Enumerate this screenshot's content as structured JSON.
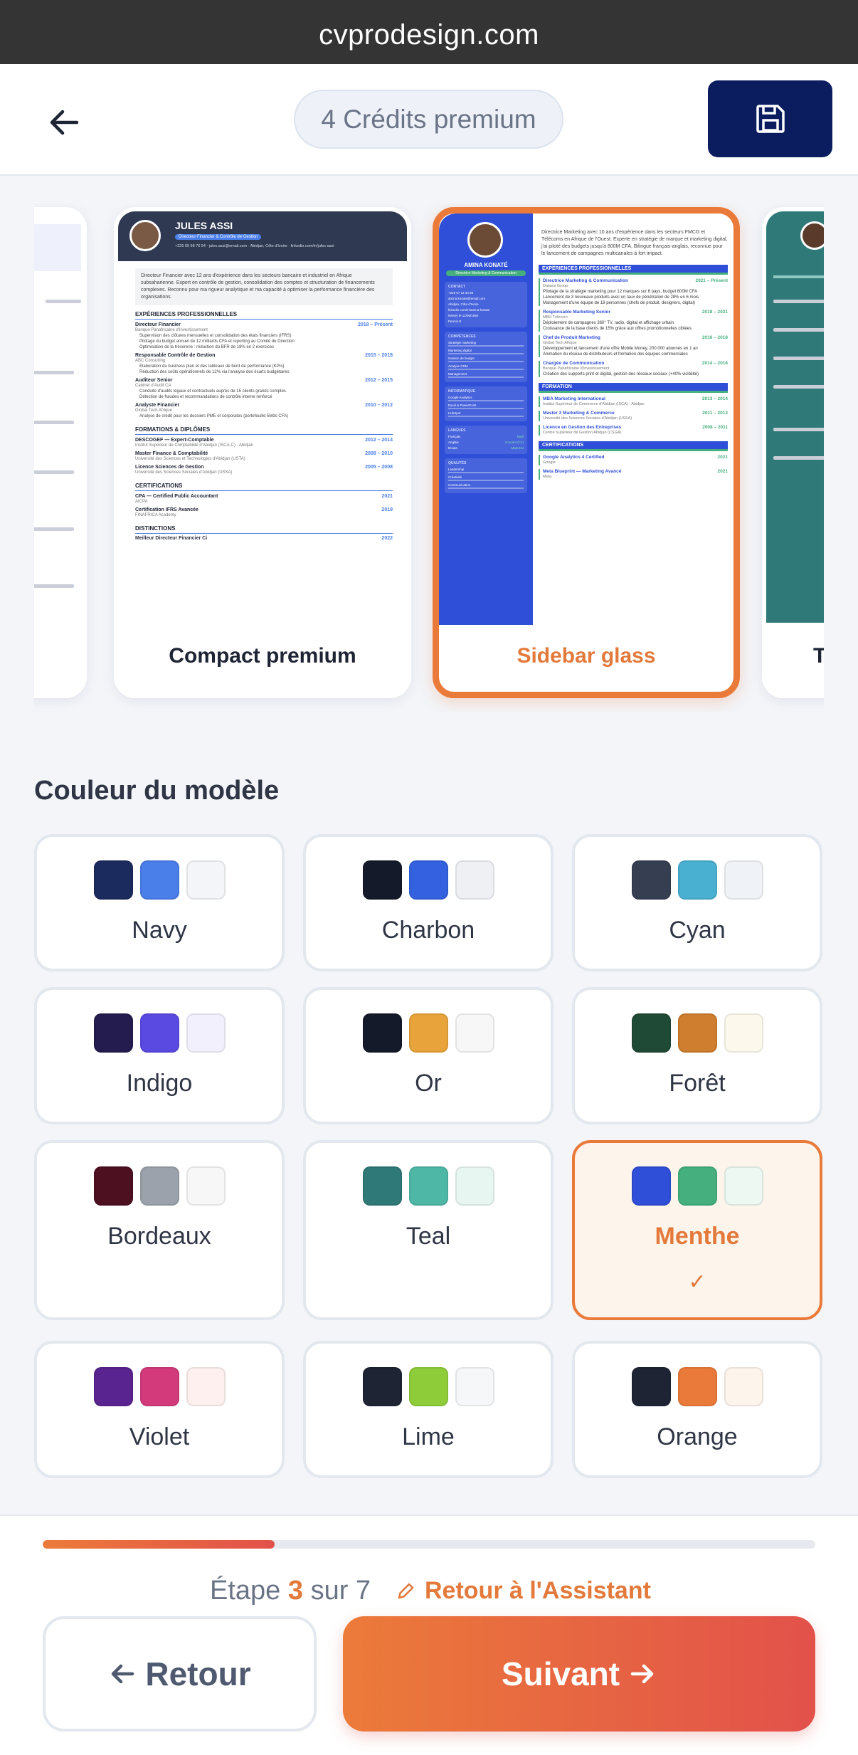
{
  "browser": {
    "url": "cvprodesign.com"
  },
  "header": {
    "credits": "4 Crédits premium"
  },
  "templates": [
    {
      "name": "Compact premium",
      "selected": false
    },
    {
      "name": "Sidebar glass",
      "selected": true
    }
  ],
  "resume_compact": {
    "name": "JULES ASSI",
    "title": "Directeur Financier & Contrôle de Gestion",
    "contact": "+225 05 98 76 54 · jules.assi@email.com · Abidjan, Côte d'Ivoire · linkedin.com/in/jules-assi",
    "summary": "Directeur Financier avec 12 ans d'expérience dans les secteurs bancaire et industriel en Afrique subsaharienne. Expert en contrôle de gestion, consolidation des comptes et structuration de financements complexes. Reconnu pour ma rigueur analytique et ma capacité à optimiser la performance financière des organisations.",
    "sec_exp": "EXPÉRIENCES PROFESSIONNELLES",
    "jobs": [
      {
        "role": "Directeur Financier",
        "date": "2018 – Présent",
        "org": "Banque Panafricaine d'Investissement",
        "bullets": [
          "Supervision des clôtures mensuelles et consolidation des états financiers (IFRS)",
          "Pilotage du budget annuel de 12 milliards CFA et reporting au Comité de Direction",
          "Optimisation de la trésorerie : réduction du BFR de 18% en 2 exercices"
        ]
      },
      {
        "role": "Responsable Contrôle de Gestion",
        "date": "2015 – 2018",
        "org": "ABC Consulting",
        "bullets": [
          "Élaboration du business plan et des tableaux de bord de performance (KPIs)",
          "Réduction des coûts opérationnels de 12% via l'analyse des écarts budgétaires"
        ]
      },
      {
        "role": "Auditeur Senior",
        "date": "2012 – 2015",
        "org": "Cabinet d'Audit CA",
        "bullets": [
          "Conduite d'audits légaux et contractuels auprès de 15 clients grands comptes",
          "Détection de fraudes et recommandations de contrôle interne renforcé"
        ]
      },
      {
        "role": "Analyste Financier",
        "date": "2010 – 2012",
        "org": "Global Tech Afrique",
        "bullets": [
          "Analyse de crédit pour les dossiers PME et corporates (portefeuille 5Mds CFA)"
        ]
      }
    ],
    "sec_edu": "FORMATIONS & DIPLÔMES",
    "edu": [
      {
        "role": "DESCOGEF — Expert-Comptable",
        "date": "2012 – 2014",
        "org": "Institut Supérieur de Comptabilité d'Abidjan (ISCA-C) - Abidjan"
      },
      {
        "role": "Master Finance & Comptabilité",
        "date": "2008 – 2010",
        "org": "Université des Sciences et Technologies d'Abidjan (USTA)"
      },
      {
        "role": "Licence Sciences de Gestion",
        "date": "2005 – 2008",
        "org": "Université des Sciences Sociales d'Abidjan (USSA)"
      }
    ],
    "sec_cert": "CERTIFICATIONS",
    "certs": [
      {
        "role": "CPA — Certified Public Accountant",
        "date": "2021",
        "org": "AICPA"
      },
      {
        "role": "Certification IFRS Avancée",
        "date": "2019",
        "org": "FINAFRICA Academy"
      }
    ],
    "sec_dist": "DISTINCTIONS",
    "dist": "Meilleur Directeur Financier Ci",
    "dist_date": "2022"
  },
  "resume_sidebar": {
    "name": "AMINA KONATÉ",
    "title": "Directrice Marketing & Communication",
    "summary": "Directrice Marketing avec 10 ans d'expérience dans les secteurs FMCG et Télécoms en Afrique de l'Ouest. Experte en stratégie de marque et marketing digital, j'ai piloté des budgets jusqu'à 800M CFA. Bilingue français-anglais, reconnue pour le lancement de campagnes multicanales à fort impact.",
    "contact_title": "CONTACT",
    "contact": [
      "+225 07 12 34 56",
      "amina.konate@email.com",
      "Abidjan, Côte d'Ivoire",
      "linkedin.com/in/amina-konate",
      "Née(e) le 12/05/1990",
      "Permis B"
    ],
    "skills_title": "COMPÉTENCES",
    "skills": [
      "Stratégie marketing",
      "Marketing digital",
      "Gestion de budget",
      "Analyse CRM",
      "Management"
    ],
    "info_title": "INFORMATIQUE",
    "info": [
      "Google Analytics",
      "Excel & PowerPoint",
      "HubSpot"
    ],
    "lang_title": "LANGUES",
    "langs": [
      [
        "Français",
        "Natif"
      ],
      [
        "Anglais",
        "Courant (C1)"
      ],
      [
        "Dioula",
        "Maternel"
      ]
    ],
    "qual_title": "QUALITÉS",
    "quals": [
      "Leadership",
      "Créativité",
      "Communication"
    ],
    "sec_exp": "EXPÉRIENCES PROFESSIONNELLES",
    "jobs": [
      {
        "role": "Directrice Marketing & Communication",
        "date": "2021 – Présent",
        "org": "Dataxis Group",
        "bullets": [
          "Pilotage de la stratégie marketing pour 12 marques sur 6 pays, budget 800M CFA",
          "Lancement de 3 nouveaux produits avec un taux de pénétration de 28% en 6 mois",
          "Management d'une équipe de 18 personnes (chefs de produit, designers, digital)"
        ]
      },
      {
        "role": "Responsable Marketing Senior",
        "date": "2018 – 2021",
        "org": "MBH Télécom",
        "bullets": [
          "Déploiement de campagnes 360° TV, radio, digital et affichage urbain",
          "Croissance de la base clients de 15% grâce aux offres promotionnelles ciblées"
        ]
      },
      {
        "role": "Chef de Produit Marketing",
        "date": "2016 – 2018",
        "org": "Global Tech Afrique",
        "bullets": [
          "Développement et lancement d'une offre Mobile Money, 200 000 abonnés en 1 an",
          "Animation du réseau de distributeurs et formation des équipes commerciales"
        ]
      },
      {
        "role": "Chargée de Communication",
        "date": "2014 – 2016",
        "org": "Banque Panafricaine d'Investissement",
        "bullets": [
          "Création des supports print et digital, gestion des réseaux sociaux (+40% visibilité)"
        ]
      }
    ],
    "sec_edu": "FORMATION",
    "edu": [
      {
        "role": "MBA Marketing International",
        "date": "2013 – 2014",
        "org": "Institut Supérieur de Commerce d'Abidjan (ISCA) - Abidjan"
      },
      {
        "role": "Master 2 Marketing & Commerce",
        "date": "2011 – 2013",
        "org": "Université des Sciences Sociales d'Abidjan (USSA)"
      },
      {
        "role": "Licence en Gestion des Entreprises",
        "date": "2008 – 2011",
        "org": "Centre Supérieur de Gestion Abidjan (CSGA)"
      }
    ],
    "sec_cert": "CERTIFICATIONS",
    "certs": [
      {
        "role": "Google Analytics 4 Certified",
        "date": "2021",
        "org": "Google"
      },
      {
        "role": "Meta Blueprint — Marketing Avancé",
        "date": "2021",
        "org": "Meta"
      }
    ]
  },
  "palette_section": {
    "title": "Couleur du modèle"
  },
  "palettes": [
    {
      "name": "Navy",
      "colors": [
        "#1c2b5e",
        "#4a7ee8",
        "#f3f5f9"
      ],
      "selected": false
    },
    {
      "name": "Charbon",
      "colors": [
        "#141a29",
        "#3461e0",
        "#eef0f3"
      ],
      "selected": false
    },
    {
      "name": "Cyan",
      "colors": [
        "#363f52",
        "#4ab0d2",
        "#eff3f7"
      ],
      "selected": false
    },
    {
      "name": "Indigo",
      "colors": [
        "#241c4e",
        "#5b4ae2",
        "#f2f0fc"
      ],
      "selected": false
    },
    {
      "name": "Or",
      "colors": [
        "#141a29",
        "#e8a33a",
        "#f7f7f8"
      ],
      "selected": false
    },
    {
      "name": "Forêt",
      "colors": [
        "#1f4a36",
        "#cf7d2e",
        "#fcf9ec"
      ],
      "selected": false
    },
    {
      "name": "Bordeaux",
      "colors": [
        "#4d1020",
        "#9ca2ab",
        "#f7f7f8"
      ],
      "selected": false
    },
    {
      "name": "Teal",
      "colors": [
        "#2f7a78",
        "#4fb7a6",
        "#e8f6f2"
      ],
      "selected": false
    },
    {
      "name": "Menthe",
      "colors": [
        "#2f4fd8",
        "#45b07e",
        "#ecf8f1"
      ],
      "selected": true,
      "check": "✓"
    },
    {
      "name": "Violet",
      "colors": [
        "#5a2490",
        "#d23a7c",
        "#fdf0ef"
      ],
      "selected": false
    },
    {
      "name": "Lime",
      "colors": [
        "#1e2433",
        "#8fcc3a",
        "#f5f7f9"
      ],
      "selected": false
    },
    {
      "name": "Orange",
      "colors": [
        "#1e2433",
        "#ea7a3a",
        "#fdf5ec"
      ],
      "selected": false
    }
  ],
  "footer": {
    "progress": 0.3,
    "step_prefix": "Étape",
    "step_current": "3",
    "step_suffix": "sur 7",
    "assistant_link": "Retour à l'Assistant",
    "back_label": "Retour",
    "next_label": "Suivant"
  },
  "accent_color": "#ea7a3a"
}
